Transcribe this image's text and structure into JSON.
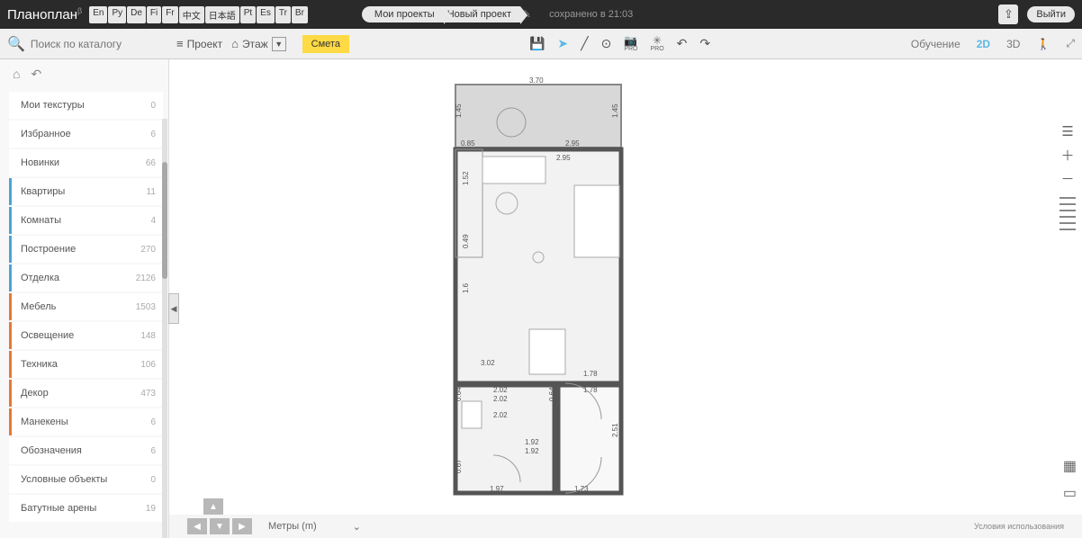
{
  "header": {
    "logo": "Планоплан",
    "logo_sup": "β",
    "languages": [
      "En",
      "Ру",
      "De",
      "Fi",
      "Fr",
      "中文",
      "日本語",
      "Pt",
      "Es",
      "Tr",
      "Br"
    ],
    "breadcrumb": {
      "projects": "Мои проекты",
      "current": "Новый проект"
    },
    "save_status": "сохранено в 21:03",
    "logout": "Выйти"
  },
  "toolbar": {
    "search_placeholder": "Поиск по каталогу",
    "project": "Проект",
    "floor": "Этаж",
    "estimate": "Смета",
    "training": "Обучение",
    "view_2d": "2D",
    "view_3d": "3D"
  },
  "sidebar": {
    "categories": [
      {
        "label": "Мои текстуры",
        "count": "0",
        "cls": ""
      },
      {
        "label": "Избранное",
        "count": "6",
        "cls": ""
      },
      {
        "label": "Новинки",
        "count": "66",
        "cls": ""
      },
      {
        "label": "Квартиры",
        "count": "11",
        "cls": "blue"
      },
      {
        "label": "Комнаты",
        "count": "4",
        "cls": "blue"
      },
      {
        "label": "Построение",
        "count": "270",
        "cls": "blue"
      },
      {
        "label": "Отделка",
        "count": "2126",
        "cls": "blue"
      },
      {
        "label": "Мебель",
        "count": "1503",
        "cls": "orange"
      },
      {
        "label": "Освещение",
        "count": "148",
        "cls": "orange"
      },
      {
        "label": "Техника",
        "count": "106",
        "cls": "orange"
      },
      {
        "label": "Декор",
        "count": "473",
        "cls": "orange"
      },
      {
        "label": "Манекены",
        "count": "6",
        "cls": "orange"
      },
      {
        "label": "Обозначения",
        "count": "6",
        "cls": ""
      },
      {
        "label": "Условные объекты",
        "count": "0",
        "cls": ""
      },
      {
        "label": "Батутные арены",
        "count": "19",
        "cls": ""
      }
    ]
  },
  "floorplan": {
    "dims": {
      "top_width": "3.70",
      "balcony_h_left": "1.45",
      "balcony_h_right": "1.45",
      "balcony_bottom_left": "0.85",
      "balcony_bottom_right": "2.95",
      "room_top_right": "2.95",
      "wall_152": "1.52",
      "wall_049": "0.49",
      "wall_16": "1.6",
      "d_202a": "2.02",
      "d_202b": "2.02",
      "d_202c": "2.02",
      "d_064a": "0.64",
      "d_064b": "0.64",
      "d_178a": "1.78",
      "d_178b": "1.78",
      "d_251": "2.51",
      "d_192a": "1.92",
      "d_192b": "1.92",
      "d_067": "0.67",
      "d_197": "1.97",
      "d_173": "1.73",
      "d_302": "3.02"
    }
  },
  "bottom": {
    "units": "Метры (m)",
    "terms": "Условия использования"
  }
}
